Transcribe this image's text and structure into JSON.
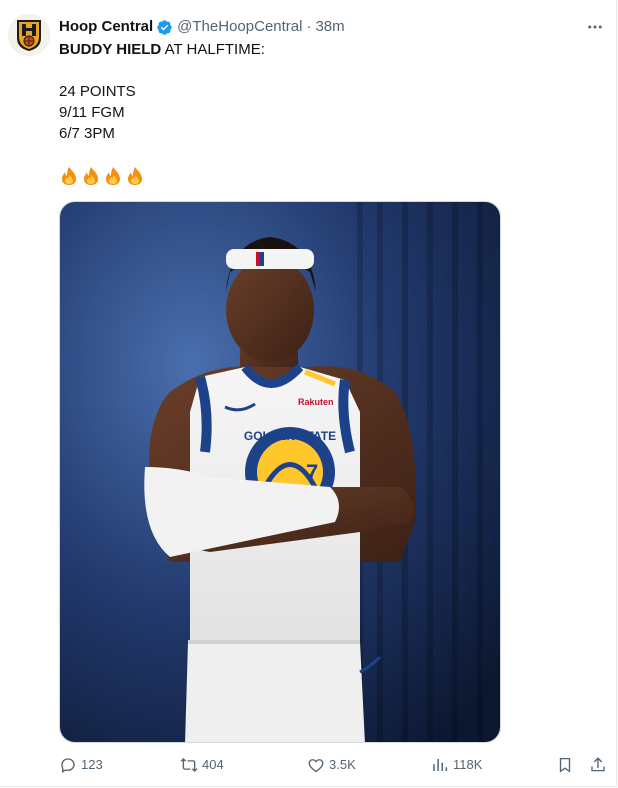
{
  "author": {
    "name": "Hoop Central",
    "handle": "@TheHoopCentral",
    "separator": "·",
    "time": "38m",
    "verified_color": "#1d9bf0"
  },
  "tweet": {
    "line1_bold": "BUDDY HIELD",
    "line1_rest": " AT HALFTIME:",
    "stats": [
      "24 POINTS",
      "9/11 FGM",
      "6/7 3PM"
    ],
    "emojis": [
      "fire-emoji",
      "fire-emoji",
      "fire-emoji",
      "fire-emoji"
    ]
  },
  "media": {
    "jersey_text": "GOLDEN STATE",
    "sponsor": "Rakuten",
    "number": "7"
  },
  "actions": {
    "replies": "123",
    "reposts": "404",
    "likes": "3.5K",
    "views": "118K"
  },
  "icons": {
    "more": "more-icon",
    "reply": "reply-icon",
    "repost": "repost-icon",
    "like": "like-icon",
    "views": "views-icon",
    "bookmark": "bookmark-icon",
    "share": "share-icon"
  },
  "colors": {
    "text": "#0f1419",
    "secondary": "#536471",
    "accent": "#1d9bf0"
  }
}
